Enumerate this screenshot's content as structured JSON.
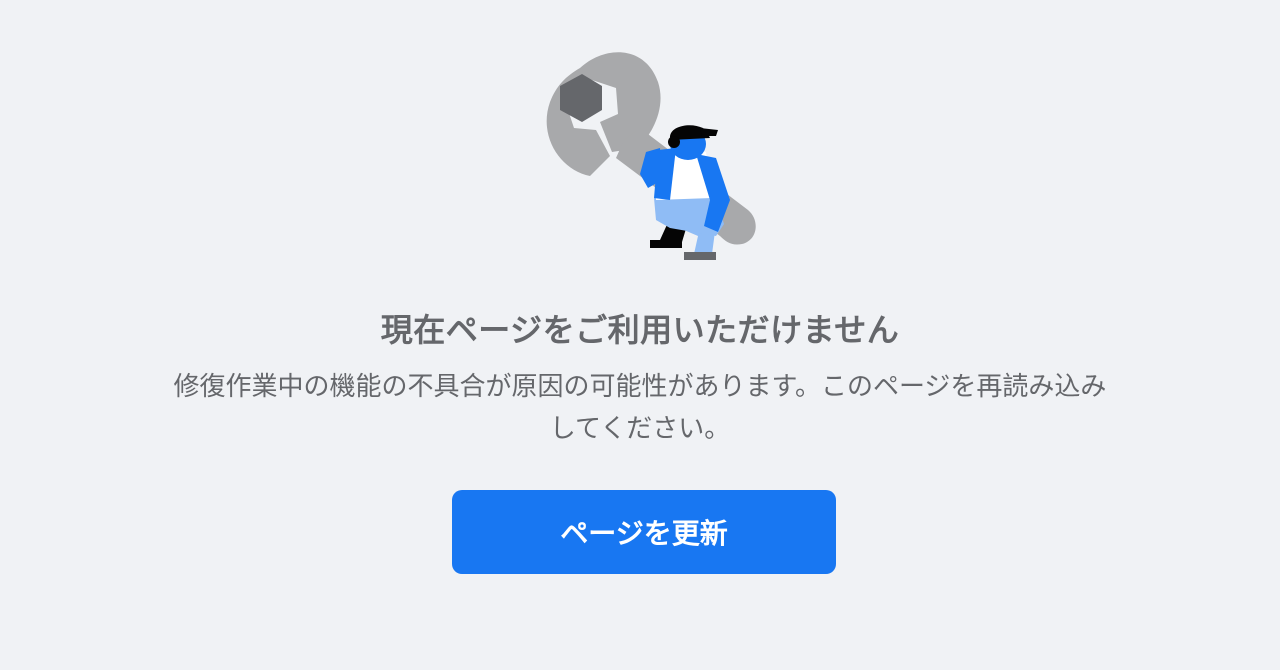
{
  "error": {
    "title": "現在ページをご利用いただけません",
    "description": "修復作業中の機能の不具合が原因の可能性があります。このページを再読み込みしてください。",
    "refresh_label": "ページを更新"
  },
  "colors": {
    "background": "#f0f2f5",
    "text": "#65676b",
    "button": "#1877f2",
    "button_text": "#ffffff",
    "wrench": "#a8a9ab",
    "bolt": "#65676b",
    "figure_blue": "#1877f2",
    "figure_light_blue": "#8fbcf5"
  },
  "icons": {
    "illustration": "maintenance-worker-with-wrench"
  }
}
